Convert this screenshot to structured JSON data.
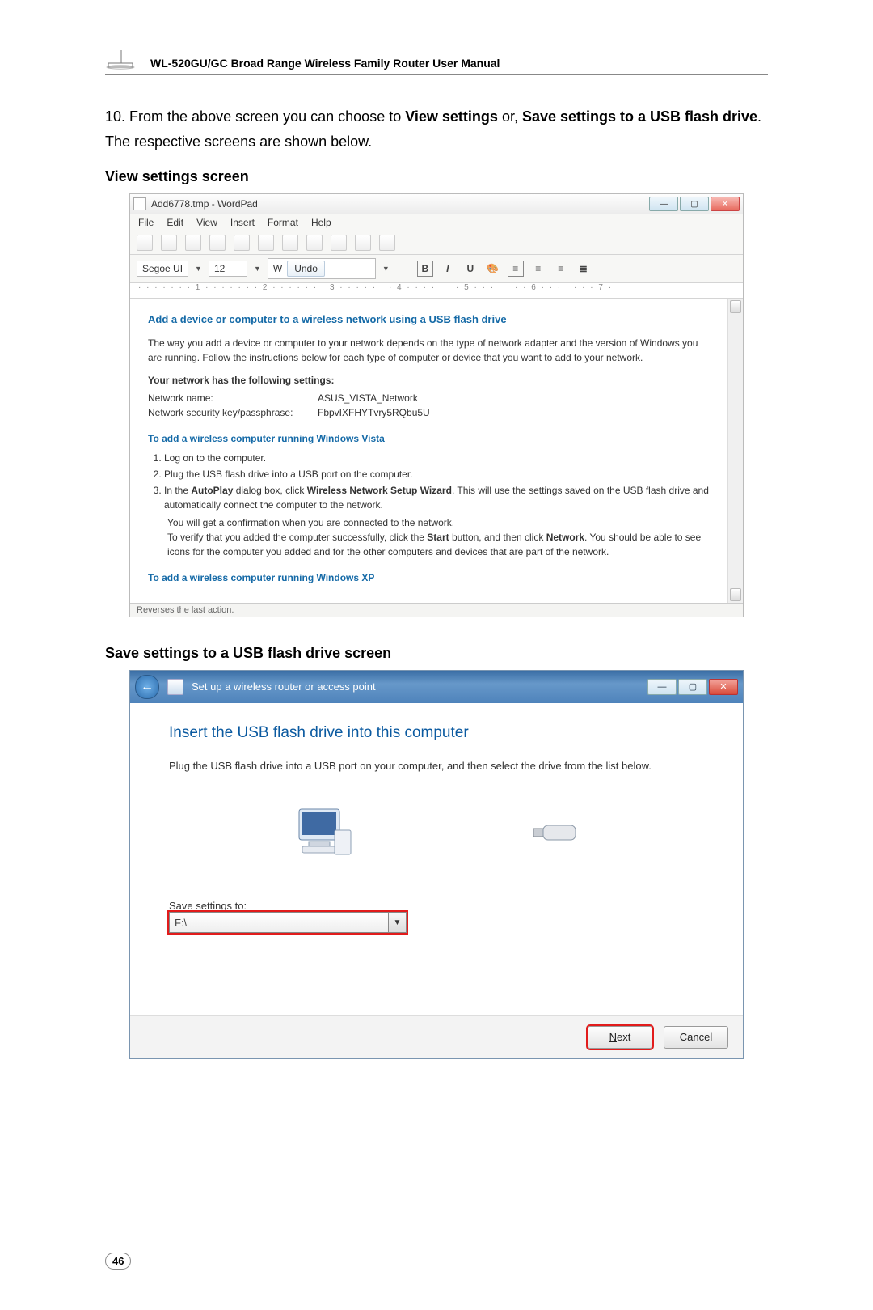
{
  "header": {
    "manual_title": "WL-520GU/GC Broad Range Wireless Family Router User Manual"
  },
  "step10": {
    "prefix": "10. From the above screen you can choose to ",
    "opt1": "View settings",
    "or": " or, ",
    "opt2": "Save settings to a USB flash drive",
    "suffix": ". The respective screens are shown below."
  },
  "sub1": "View settings screen",
  "wordpad": {
    "title": "Add6778.tmp - WordPad",
    "min": "—",
    "max": "▢",
    "close": "✕",
    "menu": [
      "File",
      "Edit",
      "View",
      "Insert",
      "Format",
      "Help"
    ],
    "font_name": "Segoe UI",
    "font_size": "12",
    "undo": "Undo",
    "ruler": "· · · · · · · 1 · · · · · · · 2 · · · · · · · 3 · · · · · · · 4 · · · · · · · 5 · · · · · · · 6 · · · · · · · 7 ·",
    "doc": {
      "h1": "Add a device or computer to a wireless network using a USB flash drive",
      "p1": "The way you add a device or computer to your network depends on the type of network adapter and the version of Windows you are running. Follow the instructions below for each type of computer or device that you want to add to your network.",
      "sect_settings": "Your network has the following settings:",
      "net_name_lbl": "Network name:",
      "net_name_val": "ASUS_VISTA_Network",
      "net_key_lbl": "Network security key/passphrase:",
      "net_key_val": "FbpvIXFHYTvry5RQbu5U",
      "h_vista": "To add a wireless computer running Windows Vista",
      "li1": "Log on to the computer.",
      "li2": "Plug the USB flash drive into a USB port on the computer.",
      "li3a": "In the ",
      "li3b": "AutoPlay",
      "li3c": " dialog box, click ",
      "li3d": "Wireless Network Setup Wizard",
      "li3e": ". This will use the settings saved on the USB flash drive and automatically connect the computer to the network.",
      "p2": "You will get a confirmation when you are connected to the network.",
      "p3a": "To verify that you added the computer successfully, click the ",
      "p3b": "Start",
      "p3c": " button, and then click ",
      "p3d": "Network",
      "p3e": ". You should be able to see icons for the computer you added and for the other computers and devices that are part of the network.",
      "h_xp": "To add a wireless computer running Windows XP"
    },
    "status": "Reverses the last action."
  },
  "sub2": "Save settings to a USB flash drive screen",
  "wizard": {
    "back": "←",
    "min": "—",
    "max": "▢",
    "close": "✕",
    "crumb": "Set up a wireless router or access point",
    "h": "Insert the USB flash drive into this computer",
    "p": "Plug the USB flash drive into a USB port on your computer, and then select the drive from the list below.",
    "save_lbl_u": "S",
    "save_lbl_rest": "ave settings to:",
    "drive": "F:\\",
    "next_u": "N",
    "next_rest": "ext",
    "cancel": "Cancel"
  },
  "page_number": "46"
}
